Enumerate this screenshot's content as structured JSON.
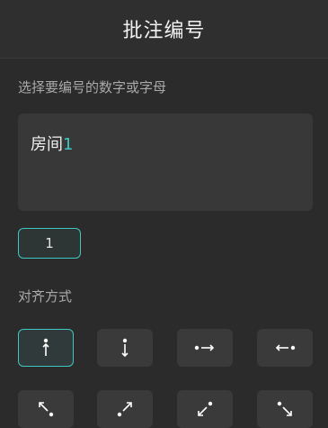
{
  "header": {
    "title": "批注编号"
  },
  "hint": "选择要编号的数字或字母",
  "text_area": {
    "label": "房间",
    "number": "1"
  },
  "number_chip": {
    "value": "1"
  },
  "alignment": {
    "label": "对齐方式",
    "options": [
      {
        "icon": "arrow-up-icon",
        "selected": true
      },
      {
        "icon": "arrow-down-icon",
        "selected": false
      },
      {
        "icon": "arrow-right-icon",
        "selected": false
      },
      {
        "icon": "arrow-left-icon",
        "selected": false
      },
      {
        "icon": "arrow-up-left-icon",
        "selected": false
      },
      {
        "icon": "arrow-up-right-icon",
        "selected": false
      },
      {
        "icon": "arrow-down-left-icon",
        "selected": false
      },
      {
        "icon": "arrow-down-right-icon",
        "selected": false
      }
    ]
  },
  "colors": {
    "accent": "#3fc6c2",
    "background": "#2b2b2b",
    "panel": "#383838"
  }
}
